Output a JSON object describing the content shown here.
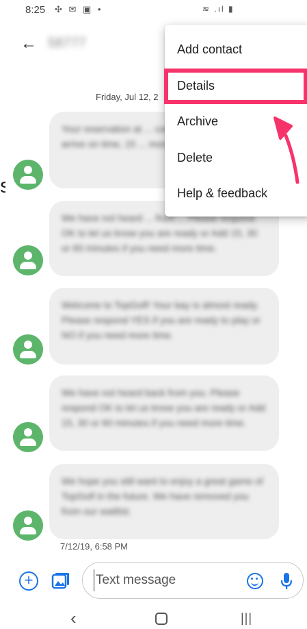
{
  "status_bar": {
    "time": "8:25",
    "left_icons": "✣ ✉ ▣ •",
    "right_icons": "≋ .ıl ▮"
  },
  "app_bar": {
    "back_icon": "←",
    "contact_name": "58777"
  },
  "conversation": {
    "date_header": "Friday, Jul 12, 2",
    "messages": [
      "Your reservation at ... coming up! Respond ... arrive on time, 15 ... more time or 'Can ...",
      "We have not heard ... from ... Please respond OK to let us know you are ready or Add 15, 30 or 60 minutes if you need more time.",
      "Welcome to TopGolf! Your bay is almost ready. Please respond YES if you are ready to play or NO if you need more time.",
      "We have not heard back from you. Please respond OK to let us know you are ready or Add 15, 30 or 60 minutes if you need more time.",
      "We hope you still want to enjoy a great game of TopGolf in the future. We have removed you from our waitlist."
    ],
    "timestamp": "7/12/19, 6:58 PM",
    "edge_glyph": "s"
  },
  "compose": {
    "placeholder": "Text message"
  },
  "menu": {
    "items": [
      "Add contact",
      "Details",
      "Archive",
      "Delete",
      "Help & feedback"
    ]
  },
  "nav_bar": {
    "back": "‹",
    "recents": "|||"
  },
  "colors": {
    "avatar": "#5cb56b",
    "accent": "#1a73e8",
    "highlight": "#f7336b",
    "bubble": "#eeeeee"
  }
}
